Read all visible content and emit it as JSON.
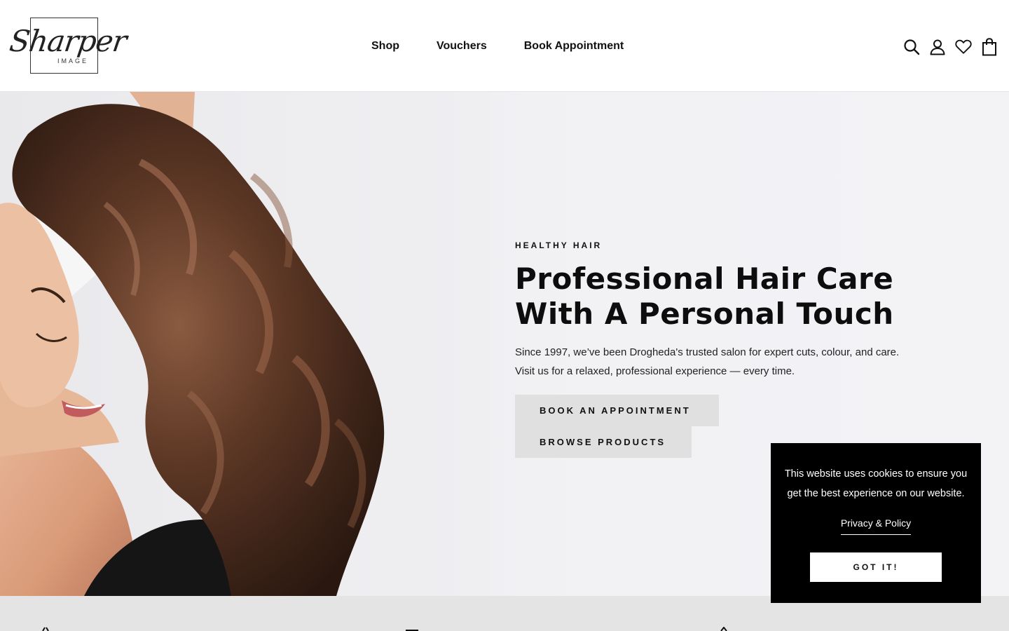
{
  "brand": {
    "logo_script": "Sharper",
    "logo_sub": "IMAGE"
  },
  "nav": {
    "items": [
      "Shop",
      "Vouchers",
      "Book Appointment"
    ]
  },
  "header_icons": [
    "search-icon",
    "account-icon",
    "wishlist-heart-icon",
    "cart-bag-icon"
  ],
  "hero": {
    "eyebrow": "HEALTHY HAIR",
    "headline_line1": "Professional Hair Care",
    "headline_line2": "With A Personal Touch",
    "lead_line1": "Since 1997, we’ve been Drogheda's trusted salon for expert cuts, colour, and care.",
    "lead_line2": "Visit us for a relaxed, professional experience — every time.",
    "button_primary": "BOOK AN APPOINTMENT",
    "button_secondary": "BROWSE PRODUCTS"
  },
  "cookie": {
    "message": "This website uses cookies to ensure you get the best experience on our website.",
    "policy_link": "Privacy & Policy",
    "accept": "GOT IT!"
  },
  "colors": {
    "text": "#111111",
    "button_bg": "#e0e0e0",
    "cookie_bg": "#000000",
    "hero_bg": "#efeff2",
    "strip_bg": "#e4e4e4"
  }
}
